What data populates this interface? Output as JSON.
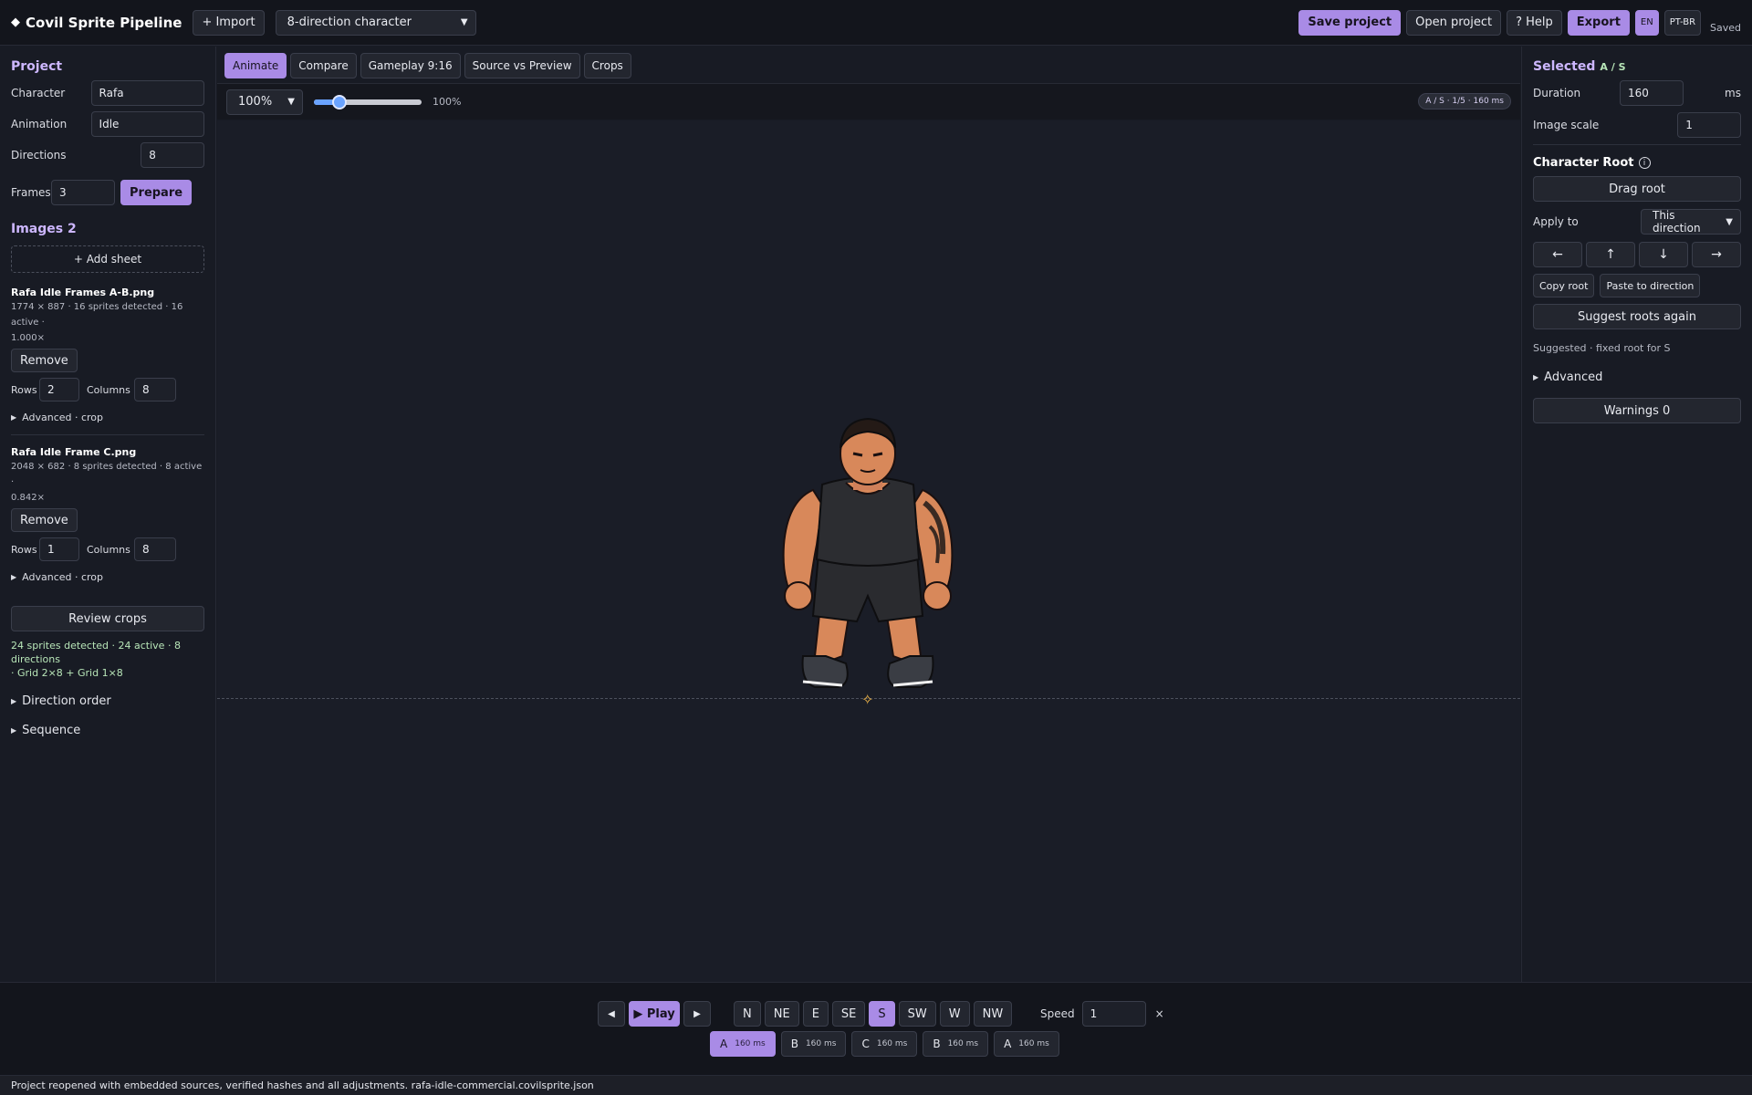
{
  "topbar": {
    "brand": "Covil Sprite Pipeline",
    "import_label": "+ Import",
    "preset": "8-direction character",
    "save_label": "Save project",
    "open_label": "Open project",
    "help_label": "? Help",
    "export_label": "Export",
    "lang_en": "EN",
    "lang_ptbr": "PT-BR",
    "saved_status": "Saved"
  },
  "project": {
    "title": "Project",
    "character_label": "Character",
    "character_value": "Rafa",
    "animation_label": "Animation",
    "animation_value": "Idle",
    "directions_label": "Directions",
    "directions_value": "8",
    "frames_label": "Frames",
    "frames_value": "3",
    "prepare_label": "Prepare"
  },
  "images": {
    "title": "Images 2",
    "add_sheet": "+ Add sheet",
    "sheets": [
      {
        "name": "Rafa Idle Frames A-B.png",
        "meta_1": "1774 × 887 · 16 sprites detected · 16 active ·",
        "meta_2": "1.000×",
        "remove": "Remove",
        "rows_label": "Rows",
        "rows": "2",
        "cols_label": "Columns",
        "cols": "8",
        "advanced": "Advanced · crop"
      },
      {
        "name": "Rafa Idle Frame C.png",
        "meta_1": "2048 × 682 · 8 sprites detected · 8 active ·",
        "meta_2": "0.842×",
        "remove": "Remove",
        "rows_label": "Rows",
        "rows": "1",
        "cols_label": "Columns",
        "cols": "8",
        "advanced": "Advanced · crop"
      }
    ],
    "review_crops": "Review crops",
    "summary_1": "24 sprites detected · 24 active · 8 directions",
    "summary_2": "· Grid 2×8 + Grid 1×8",
    "direction_order": "Direction order",
    "sequence": "Sequence"
  },
  "center": {
    "tabs": [
      "Animate",
      "Compare",
      "Gameplay 9:16",
      "Source vs Preview",
      "Crops"
    ],
    "active_tab": "Animate",
    "zoom_select": "100%",
    "zoom_value_label": "100%",
    "zoom_slider_fraction": 0.2,
    "frame_badge": "A / S · 1/5 · 160 ms"
  },
  "right": {
    "selected_label": "Selected",
    "selected_value": "A / S",
    "duration_label": "Duration",
    "duration_value": "160",
    "duration_unit": "ms",
    "scale_label": "Image scale",
    "scale_value": "1",
    "root_title": "Character Root",
    "drag_root": "Drag root",
    "apply_label": "Apply to",
    "apply_value": "This direction",
    "arrows": [
      "←",
      "↑",
      "↓",
      "→"
    ],
    "copy_root": "Copy root",
    "paste_root": "Paste to direction",
    "suggest": "Suggest roots again",
    "suggest_note": "Suggested · fixed root for S",
    "advanced": "Advanced",
    "warnings": "Warnings 0"
  },
  "playback": {
    "prev": "◀",
    "play": "▶ Play",
    "next": "▶",
    "directions": [
      "N",
      "NE",
      "E",
      "SE",
      "S",
      "SW",
      "W",
      "NW"
    ],
    "active_direction": "S",
    "speed_label": "Speed",
    "speed_value": "1",
    "speed_unit": "×",
    "frames": [
      {
        "letter": "A",
        "ms": "160 ms"
      },
      {
        "letter": "B",
        "ms": "160 ms"
      },
      {
        "letter": "C",
        "ms": "160 ms"
      },
      {
        "letter": "B",
        "ms": "160 ms"
      },
      {
        "letter": "A",
        "ms": "160 ms"
      }
    ],
    "active_frame_index": 0
  },
  "status": "Project reopened with embedded sources, verified hashes and all adjustments. rafa-idle-commercial.covilsprite.json",
  "colors": {
    "accent": "#a98be6",
    "background": "#181b24",
    "success_text": "#b8e6b8",
    "root_marker": "#f0b64a"
  }
}
